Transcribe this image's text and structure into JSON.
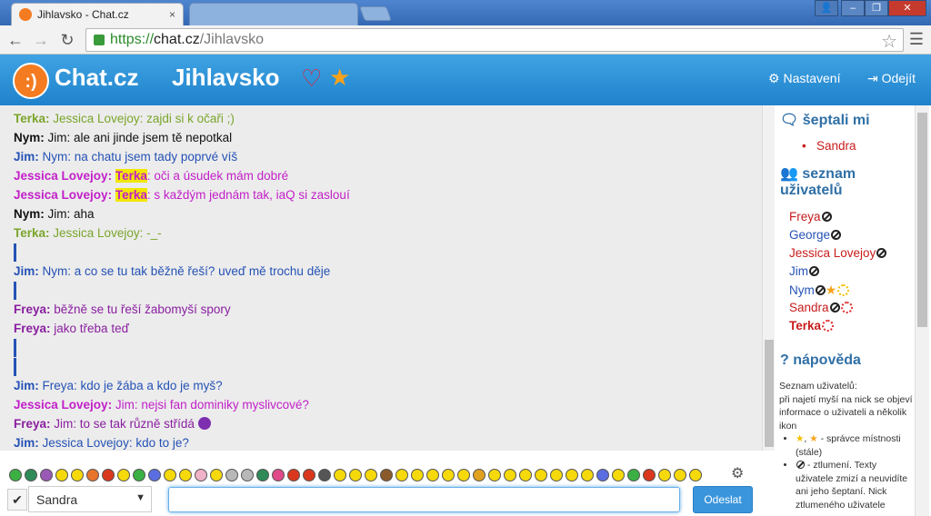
{
  "browser": {
    "tab_title": "Jihlavsko - Chat.cz",
    "tab_close": "×",
    "url_protocol": "https://",
    "url_host": "chat.cz",
    "url_path": "/Jihlavsko"
  },
  "header": {
    "logo_mark": ":)",
    "logo_text": "Chat.cz",
    "room": "Jihlavsko",
    "settings": "Nastavení",
    "logout": "Odejít"
  },
  "messages": [
    {
      "nick": "Terka",
      "text": "Jessica Lovejoy: zajdi si k očaři ;)",
      "color": "#7aa52a"
    },
    {
      "nick": "Nym",
      "text": "Jim: ale ani jinde jsem tě nepotkal",
      "color": "#111111"
    },
    {
      "nick": "Jim",
      "text": "Nym: na chatu jsem tady poprvé víš",
      "color": "#2552b5"
    },
    {
      "nick": "Jessica Lovejoy",
      "mention": "Terka",
      "text": ": oči a úsudek mám dobré",
      "color": "#c21fc8"
    },
    {
      "nick": "Jessica Lovejoy",
      "mention": "Terka",
      "text": ": s každým jednám tak, iaQ si zaslouí",
      "color": "#c21fc8"
    },
    {
      "nick": "Nym",
      "text": "Jim: aha",
      "color": "#111111"
    },
    {
      "nick": "Terka",
      "text": "Jessica Lovejoy: -_-",
      "color": "#7aa52a"
    },
    {
      "nick": "Jim",
      "text": "Nym: a co se tu tak běžně řeší? uveď mě trochu děje",
      "color": "#2552b5"
    },
    {
      "nick": "Freya",
      "text": "běžně se tu řeší žabomyší spory",
      "color": "#8a1fa0"
    },
    {
      "nick": "Freya",
      "text": "jako třeba teď",
      "color": "#8a1fa0"
    },
    {
      "nick": "Jim",
      "text": "Freya: kdo je žába a kdo je myš?",
      "color": "#2552b5"
    },
    {
      "nick": "Jessica Lovejoy",
      "text": "Jim: nejsi fan dominiky myslivcové?",
      "color": "#c21fc8"
    },
    {
      "nick": "Freya",
      "text": "Jim: to se tak různě střídá",
      "color": "#8a1fa0"
    },
    {
      "nick": "Jim",
      "text": "Jessica Lovejoy: kdo to je?",
      "color": "#2552b5"
    }
  ],
  "sidebar": {
    "whispered_heading": "šeptali mi",
    "whispered": [
      "Sandra"
    ],
    "users_heading_1": "seznam",
    "users_heading_2": "uživatelů",
    "users": [
      {
        "name": "Freya",
        "color": "#c81c1c"
      },
      {
        "name": "George",
        "color": "#2552b5"
      },
      {
        "name": "Jessica Lovejoy",
        "color": "#c81c1c"
      },
      {
        "name": "Jim",
        "color": "#2552b5"
      },
      {
        "name": "Nym",
        "color": "#2552b5"
      },
      {
        "name": "Sandra",
        "color": "#c81c1c"
      },
      {
        "name": "Terka",
        "color": "#c81c1c"
      }
    ],
    "help_heading": "nápověda",
    "help_intro_1": "Seznam uživatelů:",
    "help_intro_2": "při najetí myší na nick se objeví informace o uživateli a několik ikon",
    "help_item_1": "- správce místnosti (stále)",
    "help_item_2": "- ztlumení. Texty uživatele zmizí a neuvidíte ani jeho šeptaní. Nick ztlumeného uživatele"
  },
  "composer": {
    "recipient": "Sandra",
    "send_label": "Odeslat",
    "checkbox": "✔"
  }
}
